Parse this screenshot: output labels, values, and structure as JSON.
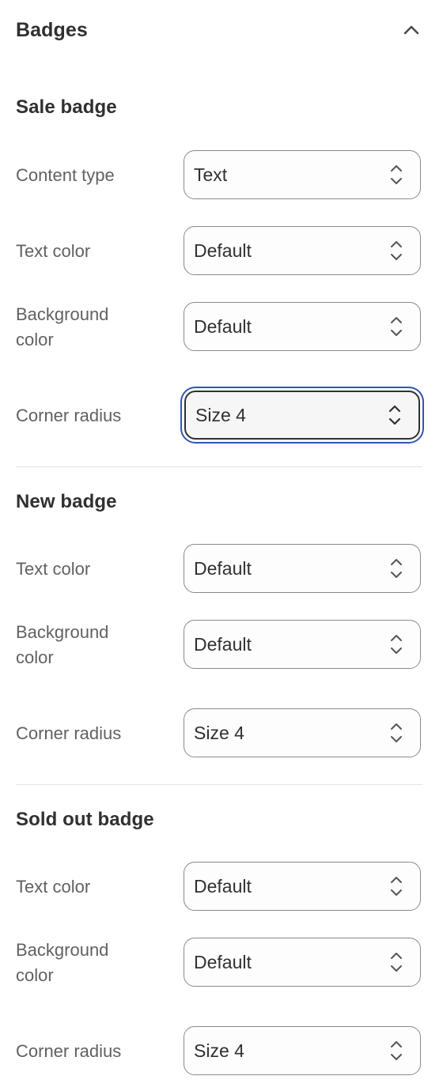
{
  "panel": {
    "title": "Badges",
    "collapse_icon": "chevron-up-icon"
  },
  "sections": {
    "sale": {
      "title": "Sale badge",
      "content_type": {
        "label": "Content type",
        "value": "Text"
      },
      "text_color": {
        "label": "Text color",
        "value": "Default"
      },
      "background_color": {
        "label_line1": "Background",
        "label_line2": "color",
        "value": "Default"
      },
      "corner_radius": {
        "label": "Corner radius",
        "value": "Size 4",
        "focused": true
      }
    },
    "new": {
      "title": "New badge",
      "text_color": {
        "label": "Text color",
        "value": "Default"
      },
      "background_color": {
        "label_line1": "Background",
        "label_line2": "color",
        "value": "Default"
      },
      "corner_radius": {
        "label": "Corner radius",
        "value": "Size 4"
      }
    },
    "sold_out": {
      "title": "Sold out badge",
      "text_color": {
        "label": "Text color",
        "value": "Default"
      },
      "background_color": {
        "label_line1": "Background",
        "label_line2": "color",
        "value": "Default"
      },
      "corner_radius": {
        "label": "Corner radius",
        "value": "Size 4"
      }
    }
  },
  "icons": {
    "select_arrows": "select-arrows-icon"
  },
  "colors": {
    "text_primary": "#303030",
    "text_secondary": "#616161",
    "border": "#8a8a8a",
    "focus_ring": "#2f55b3",
    "divider": "#e3e3e3"
  }
}
